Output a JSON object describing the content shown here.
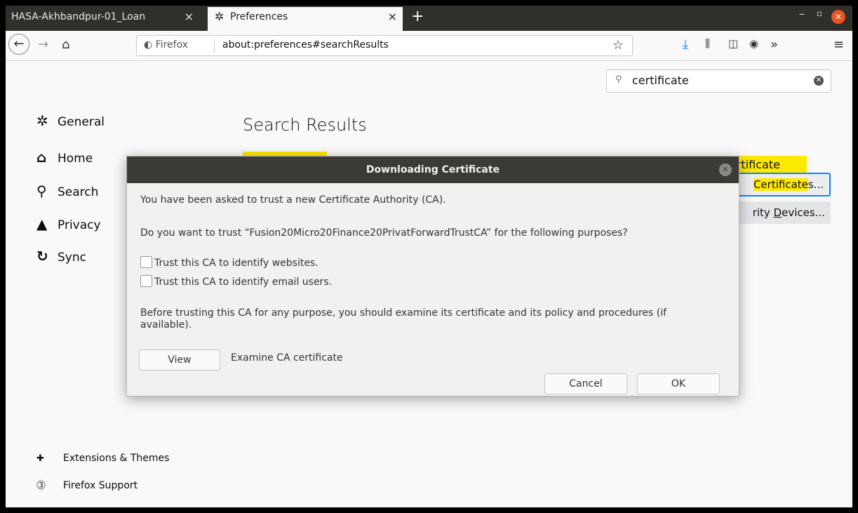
{
  "tabs": [
    {
      "label": "HASA-Akhbandpur-01_Loan",
      "close": "×"
    },
    {
      "label": "Preferences",
      "close": "×"
    }
  ],
  "new_tab": "+",
  "window_controls": {
    "min": "–",
    "max": "▫",
    "close": "✕"
  },
  "nav": {
    "identity": "Firefox",
    "url": "about:preferences#searchResults"
  },
  "search": {
    "value": "certificate"
  },
  "sidebar": {
    "items": [
      {
        "label": "General",
        "icon": "gear-icon"
      },
      {
        "label": "Home",
        "icon": "home-icon"
      },
      {
        "label": "Search",
        "icon": "search-icon"
      },
      {
        "label": "Privacy",
        "icon": "lock-icon"
      },
      {
        "label": "Sync",
        "icon": "sync-icon"
      }
    ],
    "footer": [
      {
        "label": "Extensions & Themes",
        "icon": "puzzle-icon"
      },
      {
        "label": "Firefox Support",
        "icon": "help-icon"
      }
    ]
  },
  "main": {
    "heading": "Search Results",
    "highlight_label": "ertificate",
    "view_certs": {
      "hl": "Certificate",
      "rest": "s..."
    },
    "devices": {
      "pre": "rity ",
      "u": "D",
      "post": "evices..."
    }
  },
  "dialog": {
    "title": "Downloading Certificate",
    "intro": "You have been asked to trust a new Certificate Authority (CA).",
    "question": "Do you want to trust “Fusion20Micro20Finance20PrivatForwardTrustCA” for the following purposes?",
    "chk_websites": "Trust this CA to identify websites.",
    "chk_email": "Trust this CA to identify email users.",
    "advice": "Before trusting this CA for any purpose, you should examine its certificate and its policy and procedures (if available).",
    "view_btn": "View",
    "view_desc": "Examine CA certificate",
    "cancel_btn": "Cancel",
    "ok_btn": "OK"
  }
}
